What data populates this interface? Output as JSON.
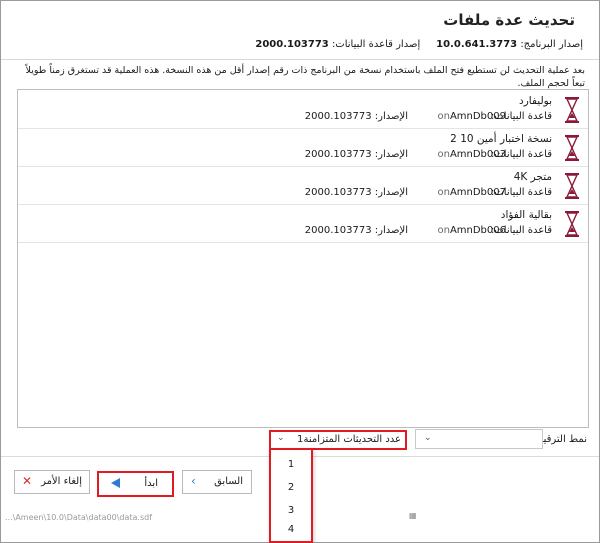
{
  "dialog": {
    "title": "تحديث عدة ملفات",
    "program_version_label": "إصدار البرنامج:",
    "program_version": "10.0.641.3773",
    "db_version_label": "إصدار قاعدة البيانات:",
    "db_version": "2000.103773",
    "info_text": "بعد عملية التحديث لن تستطيع فتح الملف باستخدام نسخة من البرنامج ذات رقم إصدار أقل من هذه النسخة. هذه العملية قد تستغرق زمناً طويلاً تبعاً لحجم الملف."
  },
  "files": [
    {
      "name": "بوليفارد",
      "db_label": "قاعدة البيانات:",
      "db_name": "AmnDb009",
      "on_label": "on",
      "version_label": "الإصدار:",
      "version": "2000.103773"
    },
    {
      "name": "نسخة اختبار أمين 10 2",
      "db_label": "قاعدة البيانات:",
      "db_name": "AmnDb003",
      "on_label": "on",
      "version_label": "الإصدار:",
      "version": "2000.103773"
    },
    {
      "name": "متجر 4K",
      "db_label": "قاعدة البيانات:",
      "db_name": "AmnDb007",
      "on_label": "on",
      "version_label": "الإصدار:",
      "version": "2000.103773"
    },
    {
      "name": "بقالية الفؤاد",
      "db_label": "قاعدة البيانات:",
      "db_name": "AmnDb006",
      "on_label": "on",
      "version_label": "الإصدار:",
      "version": "2000.103773"
    }
  ],
  "controls": {
    "upgrade_mode_label": "نمط الترقية",
    "upgrade_mode_value": "",
    "concurrent_label": "عدد التحديثات المتزامنة",
    "concurrent_value": "1",
    "concurrent_options": [
      "1",
      "2",
      "3",
      "4"
    ]
  },
  "buttons": {
    "previous": "السابق",
    "start": "ابدأ",
    "cancel": "إلغاء الأمر"
  },
  "status_path": "...\\Ameen\\10.0\\Data\\data00\\data.sdf",
  "colors": {
    "highlight_red": "#e01b24",
    "hourglass": "#8b1a3a",
    "blue_arrow": "#2b7bd6",
    "cancel_x": "#d9302c"
  }
}
